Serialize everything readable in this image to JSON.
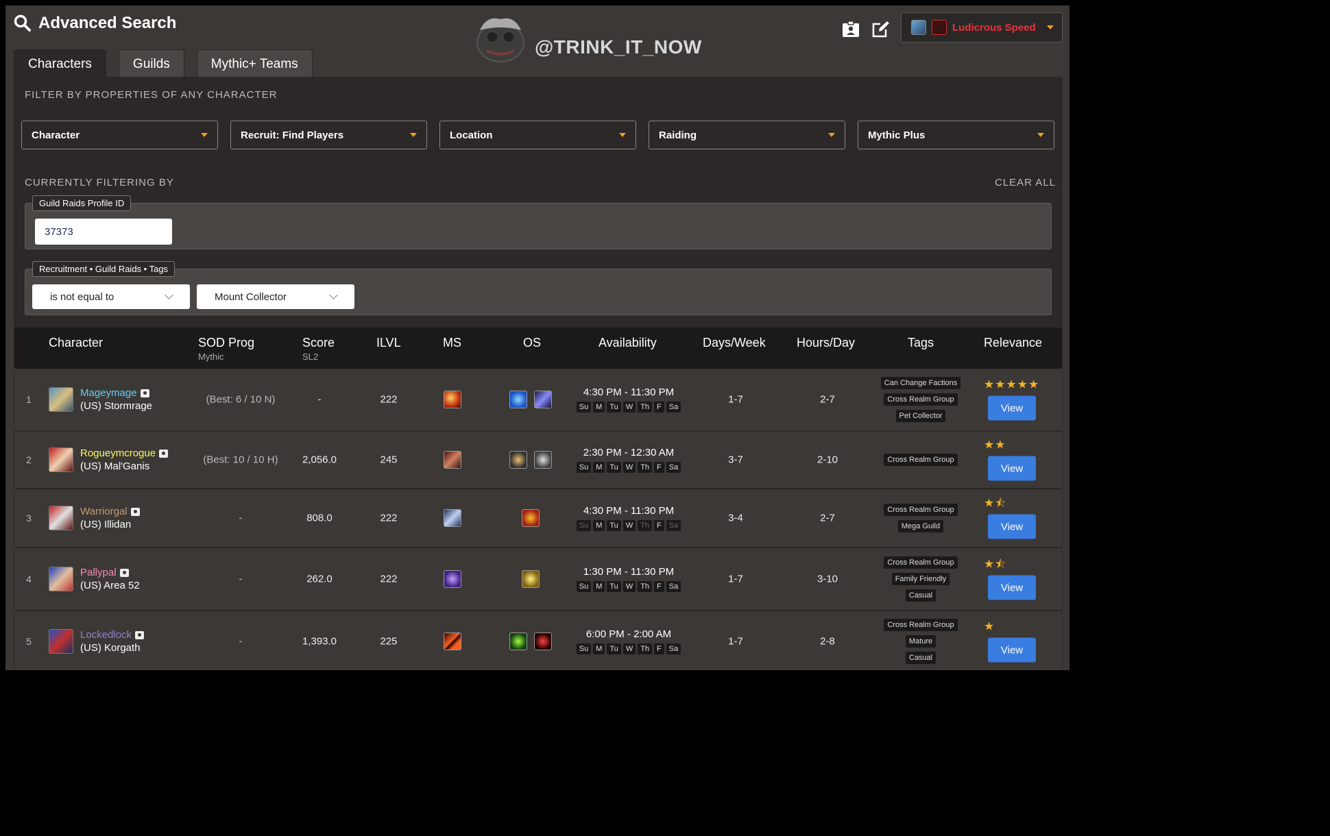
{
  "header": {
    "title": "Advanced Search",
    "brand": "@TRINK_IT_NOW",
    "account": {
      "label": "Ludicrous Speed"
    }
  },
  "tabs": [
    {
      "label": "Characters",
      "active": true
    },
    {
      "label": "Guilds",
      "active": false
    },
    {
      "label": "Mythic+ Teams",
      "active": false
    }
  ],
  "filter_section": {
    "heading": "FILTER BY PROPERTIES OF ANY CHARACTER",
    "dropdowns": [
      "Character",
      "Recruit: Find Players",
      "Location",
      "Raiding",
      "Mythic Plus"
    ]
  },
  "current_filters": {
    "heading": "CURRENTLY FILTERING BY",
    "clear_all": "CLEAR ALL",
    "profile": {
      "label": "Guild Raids Profile ID",
      "value": "37373"
    },
    "tags": {
      "label": "Recruitment • Guild Raids • Tags",
      "operator": "is not equal to",
      "value": "Mount Collector"
    }
  },
  "table": {
    "headers": {
      "character": "Character",
      "sod": "SOD Prog",
      "sod_sub": "Mythic",
      "score": "Score",
      "score_sub": "SL2",
      "ilvl": "ILVL",
      "ms": "MS",
      "os": "OS",
      "availability": "Availability",
      "days_week": "Days/Week",
      "hours_day": "Hours/Day",
      "tags": "Tags",
      "relevance": "Relevance"
    },
    "day_labels": [
      "Su",
      "M",
      "Tu",
      "W",
      "Th",
      "F",
      "Sa"
    ],
    "view_label": "View",
    "rows": [
      {
        "idx": "1",
        "name": "Mageymage",
        "name_color": "#69ccf0",
        "realm": "(US) Stormrage",
        "sod": "(Best: 6 / 10 N)",
        "score": "-",
        "ilvl": "222",
        "time": "4:30 PM - 11:30 PM",
        "days_on": [
          1,
          1,
          1,
          1,
          1,
          1,
          1
        ],
        "days_week": "1-7",
        "hours_day": "2-7",
        "tags": [
          "Can Change Factions",
          "Cross Realm Group",
          "Pet Collector"
        ],
        "stars": "★★★★★",
        "rating": 5
      },
      {
        "idx": "2",
        "name": "Rogueymcrogue",
        "name_color": "#fff569",
        "realm": "(US) Mal'Ganis",
        "sod": "(Best: 10 / 10 H)",
        "score": "2,056.0",
        "ilvl": "245",
        "time": "2:30 PM - 12:30 AM",
        "days_on": [
          1,
          1,
          1,
          1,
          1,
          1,
          1
        ],
        "days_week": "3-7",
        "hours_day": "2-10",
        "tags": [
          "Cross Realm Group"
        ],
        "stars": "★★",
        "rating": 2
      },
      {
        "idx": "3",
        "name": "Warriorgal",
        "name_color": "#c79c6e",
        "realm": "(US) Illidan",
        "sod": "-",
        "score": "808.0",
        "ilvl": "222",
        "time": "4:30 PM - 11:30 PM",
        "days_on": [
          0,
          1,
          1,
          1,
          0,
          1,
          0
        ],
        "days_week": "3-4",
        "hours_day": "2-7",
        "tags": [
          "Cross Realm Group",
          "Mega Guild"
        ],
        "stars": "★⯪",
        "rating": 1.5
      },
      {
        "idx": "4",
        "name": "Pallypal",
        "name_color": "#f58cba",
        "realm": "(US) Area 52",
        "sod": "-",
        "score": "262.0",
        "ilvl": "222",
        "time": "1:30 PM - 11:30 PM",
        "days_on": [
          1,
          1,
          1,
          1,
          1,
          1,
          1
        ],
        "days_week": "1-7",
        "hours_day": "3-10",
        "tags": [
          "Cross Realm Group",
          "Family Friendly",
          "Casual"
        ],
        "stars": "★⯪",
        "rating": 1.5
      },
      {
        "idx": "5",
        "name": "Lockedlock",
        "name_color": "#9482c9",
        "realm": "(US) Korgath",
        "sod": "-",
        "score": "1,393.0",
        "ilvl": "225",
        "time": "6:00 PM - 2:00 AM",
        "days_on": [
          1,
          1,
          1,
          1,
          1,
          1,
          1
        ],
        "days_week": "1-7",
        "hours_day": "2-8",
        "tags": [
          "Cross Realm Group",
          "Mature",
          "Casual"
        ],
        "stars": "★",
        "rating": 1
      }
    ]
  },
  "colors": {
    "accent_orange": "#f0a020",
    "button_blue": "#3a7de0",
    "speed_red": "#e8323c",
    "star": "#f5b223"
  }
}
